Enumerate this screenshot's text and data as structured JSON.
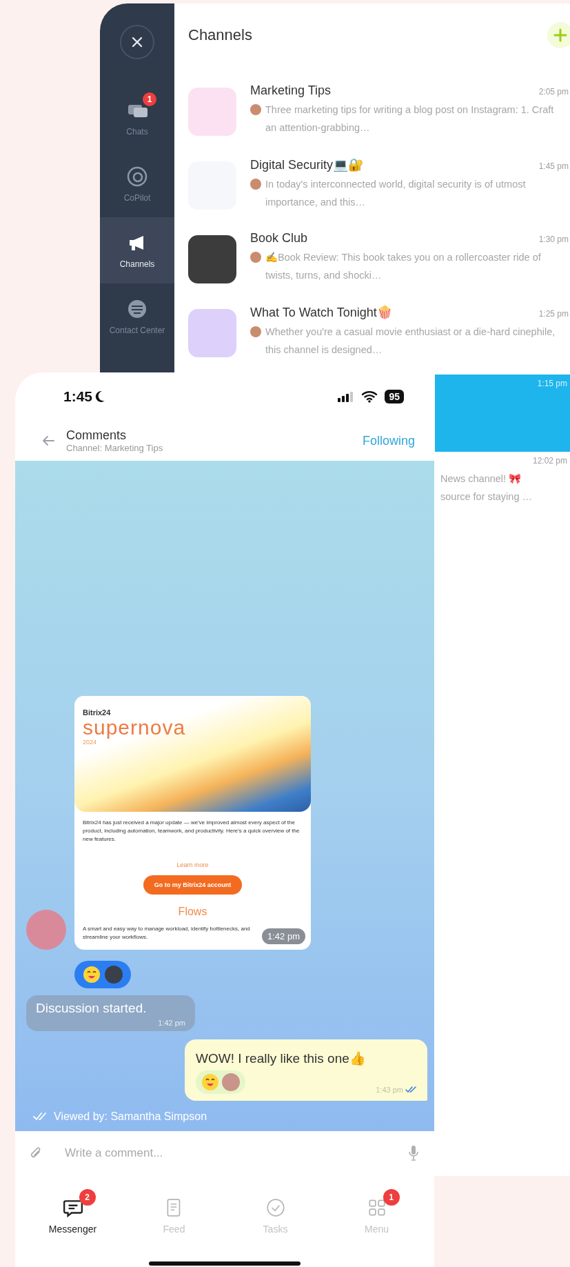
{
  "sidebar": {
    "items": [
      {
        "kind": "chats",
        "label": "Chats",
        "badge": "1",
        "selected": false
      },
      {
        "kind": "copilot",
        "label": "CoPilot",
        "selected": false
      },
      {
        "kind": "channels",
        "label": "Channels",
        "selected": true
      },
      {
        "kind": "contact",
        "label": "Contact Center",
        "selected": false
      }
    ]
  },
  "channels": {
    "title": "Channels",
    "items": [
      {
        "kind": "full",
        "name": "Marketing Tips",
        "time": "2:05 pm",
        "preview": "Three marketing tips for writing a blog post on Instagram: 1. Craft an attention-grabbing…",
        "selected": false
      },
      {
        "kind": "full",
        "name": "Digital Security💻🔐",
        "time": "1:45 pm",
        "preview": "In today's interconnected world, digital security is of utmost importance, and this…",
        "selected": false
      },
      {
        "kind": "full",
        "name": "Book Club",
        "time": "1:30 pm",
        "preview": "✍Book Review: This book takes you on a rollercoaster ride of twists, turns, and shocki…",
        "selected": false
      },
      {
        "kind": "full",
        "name": "What To Watch Tonight🍿",
        "time": "1:25 pm",
        "preview": "Whether you're a casual movie enthusiast or a die-hard cinephile, this channel is designed…",
        "selected": false
      },
      {
        "kind": "covered",
        "time": "1:15 pm",
        "selected": true
      },
      {
        "kind": "covered",
        "time": "12:02 pm",
        "lines": [
          "News channel! 🎀",
          "source for staying …"
        ],
        "selected": false
      }
    ]
  },
  "phone": {
    "status_bar": {
      "time": "1:45",
      "battery": "95"
    },
    "header": {
      "title": "Comments",
      "subtitle": "Channel: Marketing Tips",
      "action": "Following"
    },
    "messages": [
      {
        "kind": "card",
        "brand": "Bitrix24",
        "headline": "supernova",
        "year": "2024",
        "body": "Bitrix24 has just received a major update — we've improved almost every aspect of the product, including automation, teamwork, and productivity. Here's a quick overview of the new features.",
        "link": "Learn more",
        "button": "Go to my Bitrix24 account",
        "section": "Flows",
        "section_text": "A smart and easy way to manage workload, identify bottlenecks, and streamline your workflows.",
        "time": "1:42 pm"
      },
      {
        "kind": "reactions"
      },
      {
        "kind": "system",
        "text": "Discussion started.",
        "time": "1:42 pm"
      },
      {
        "kind": "outgoing",
        "text": "WOW! I really like this one👍",
        "time": "1:43 pm",
        "read": true
      }
    ],
    "viewed": "Viewed by: Samantha Simpson",
    "composer": {
      "placeholder": "Write a comment..."
    },
    "tabs": [
      {
        "kind": "messenger",
        "label": "Messenger",
        "badge": "2",
        "selected": true
      },
      {
        "kind": "feed",
        "label": "Feed",
        "selected": false
      },
      {
        "kind": "tasks",
        "label": "Tasks",
        "selected": false
      },
      {
        "kind": "menu",
        "label": "Menu",
        "badge": "1",
        "selected": false
      }
    ]
  }
}
